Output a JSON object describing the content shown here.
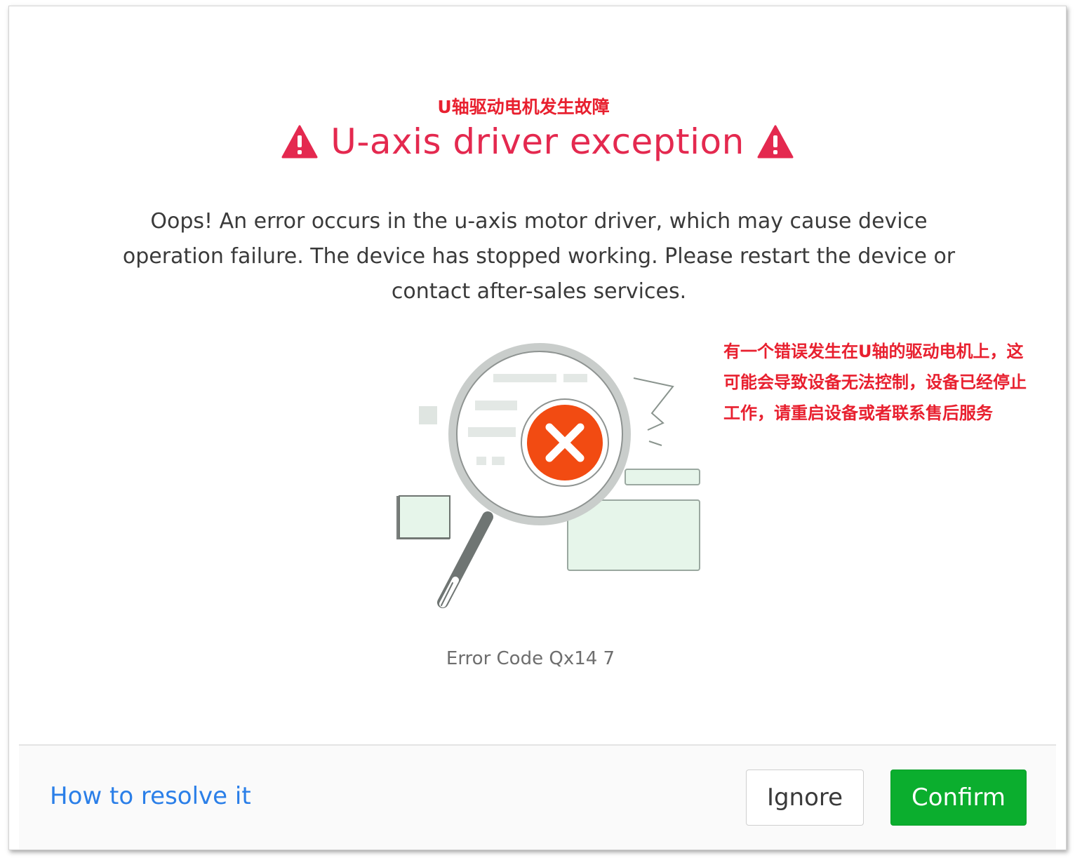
{
  "dialog": {
    "title_cn": "U轴驱动电机发生故障",
    "title": "U-axis driver exception",
    "message": "Oops! An error occurs in the u-axis motor driver, which may cause device operation failure. The device has stopped working. Please restart the device or contact after-sales services.",
    "note_cn": "有一个错误发生在U轴的驱动电机上，这可能会导致设备无法控制，设备已经停止工作，请重启设备或者联系售后服务",
    "error_code": "Error Code Qx14 7"
  },
  "footer": {
    "help_link": "How to resolve it",
    "ignore_label": "Ignore",
    "confirm_label": "Confirm"
  },
  "icons": {
    "title_icons": "warning-triangle",
    "illustration": "magnifier-with-error-x"
  },
  "colors": {
    "title": "#e4294f",
    "annotation": "#e8202f",
    "link": "#2b7fe8",
    "confirm": "#0bae2e",
    "error_badge": "#f24b12"
  }
}
